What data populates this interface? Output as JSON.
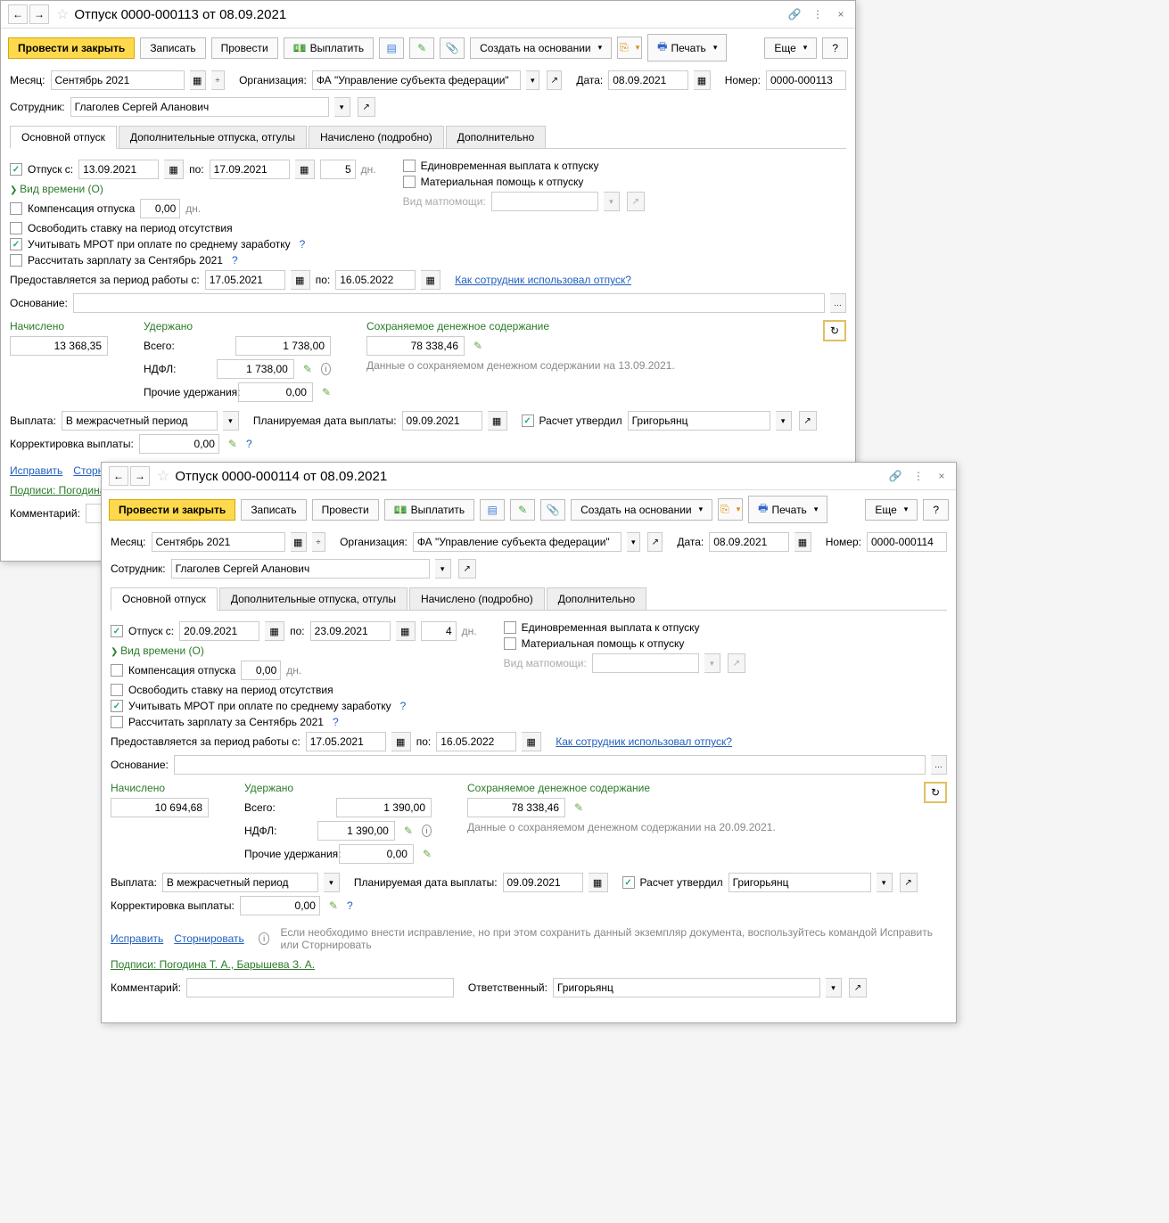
{
  "toolbar": {
    "post_close": "Провести и закрыть",
    "write": "Записать",
    "post": "Провести",
    "pay": "Выплатить",
    "create_based": "Создать на основании",
    "print": "Печать",
    "more": "Еще",
    "help": "?"
  },
  "labels": {
    "month": "Месяц:",
    "org": "Организация:",
    "date": "Дата:",
    "number": "Номер:",
    "employee": "Сотрудник:",
    "vacation_from": "Отпуск   с:",
    "to": "по:",
    "days_suffix": "дн.",
    "time_type": "Вид времени (О)",
    "compensation": "Компенсация отпуска",
    "free_rate": "Освободить ставку на период отсутствия",
    "mrot": "Учитывать МРОТ при оплате по среднему заработку",
    "calc_salary": "Рассчитать зарплату за Сентябрь 2021",
    "period_from": "Предоставляется за период работы с:",
    "reason": "Основание:",
    "accrued": "Начислено",
    "withheld": "Удержано",
    "total": "Всего:",
    "ndfl": "НДФЛ:",
    "other_with": "Прочие удержания:",
    "kept_pay": "Сохраняемое денежное содержание",
    "kept_info1": "Данные о сохраняемом денежном содержании на 13.09.2021.",
    "kept_info2": "Данные о сохраняемом денежном содержании на 20.09.2021.",
    "payout": "Выплата:",
    "plan_date": "Планируемая дата выплаты:",
    "approved": "Расчет утвердил",
    "correction": "Корректировка выплаты:",
    "comment": "Комментарий:",
    "responsible": "Ответственный:",
    "fix": "Исправить",
    "storno": "Сторнировать",
    "fix_hint": "Если необходимо внести исправление, но при этом сохранить данный экземпляр документа, воспользуйтесь командой Исправить или Сторнировать",
    "signatures": "Подписи: Погодина Т. А., Барышева З. А.",
    "signatures_short": "Подписи: Погодина Т",
    "how_used": "Как сотрудник использовал отпуск?",
    "lump_sum": "Единовременная выплата к отпуску",
    "mat_help": "Материальная помощь к отпуску",
    "mat_type": "Вид матпомощи:",
    "storno_short": "Сторниро"
  },
  "tabs": {
    "main": "Основной отпуск",
    "extra": "Дополнительные отпуска, отгулы",
    "accrued_detail": "Начислено (подробно)",
    "additional": "Дополнительно"
  },
  "win1": {
    "title": "Отпуск 0000-000113 от 08.09.2021",
    "month": "Сентябрь 2021",
    "org": "ФА \"Управление субъекта федерации\"",
    "date": "08.09.2021",
    "number": "0000-000113",
    "employee": "Глаголев Сергей Аланович",
    "from": "13.09.2021",
    "to": "17.09.2021",
    "days": "5",
    "comp_days": "0,00",
    "period_from": "17.05.2021",
    "period_to": "16.05.2022",
    "accrued": "13 368,35",
    "total_with": "1 738,00",
    "ndfl": "1 738,00",
    "other": "0,00",
    "kept_amount": "78 338,46",
    "payout_type": "В межрасчетный период",
    "plan_date": "09.09.2021",
    "approver": "Григорьянц",
    "correction": "0,00"
  },
  "win2": {
    "title": "Отпуск 0000-000114 от 08.09.2021",
    "month": "Сентябрь 2021",
    "org": "ФА \"Управление субъекта федерации\"",
    "date": "08.09.2021",
    "number": "0000-000114",
    "employee": "Глаголев Сергей Аланович",
    "from": "20.09.2021",
    "to": "23.09.2021",
    "days": "4",
    "comp_days": "0,00",
    "period_from": "17.05.2021",
    "period_to": "16.05.2022",
    "accrued": "10 694,68",
    "total_with": "1 390,00",
    "ndfl": "1 390,00",
    "other": "0,00",
    "kept_amount": "78 338,46",
    "payout_type": "В межрасчетный период",
    "plan_date": "09.09.2021",
    "approver": "Григорьянц",
    "responsible": "Григорьянц",
    "correction": "0,00"
  }
}
